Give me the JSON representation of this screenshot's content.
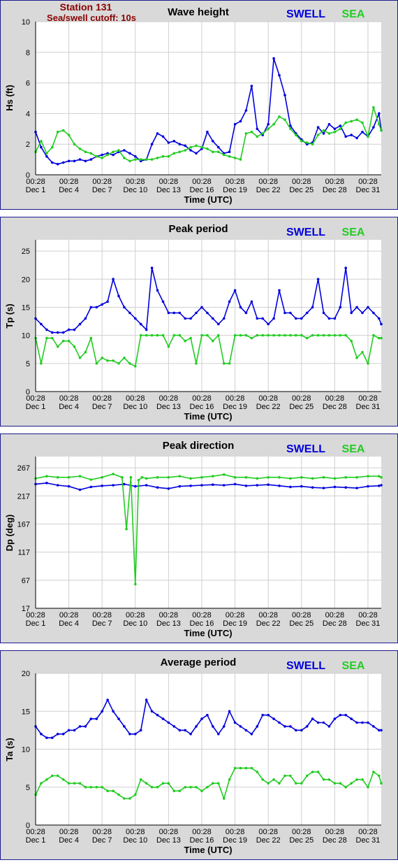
{
  "station": {
    "name": "Station 131",
    "cutoff": "Sea/swell cutoff: 10s"
  },
  "legend": {
    "swell_label": "SWELL",
    "sea_label": "SEA",
    "swell_color": "#0000dd",
    "sea_color": "#22cc22"
  },
  "x_time_labels": [
    "00:28",
    "00:28",
    "00:28",
    "00:28",
    "00:28",
    "00:28",
    "00:28",
    "00:28",
    "00:28",
    "00:28",
    "00:28"
  ],
  "x_date_labels": [
    "Dec 1",
    "Dec 4",
    "Dec 7",
    "Dec 10",
    "Dec 13",
    "Dec 16",
    "Dec 19",
    "Dec 22",
    "Dec 25",
    "Dec 28",
    "Dec 31"
  ],
  "chart_data": [
    {
      "type": "line",
      "title": "Wave height",
      "xlabel": "Time (UTC)",
      "ylabel": "Hs (ft)",
      "ylim": [
        0,
        10
      ],
      "yticks": [
        0,
        2,
        4,
        6,
        8,
        10
      ],
      "xlim": [
        0,
        31.2
      ],
      "grid": true,
      "series": [
        {
          "name": "SWELL",
          "x": [
            0,
            0.5,
            1,
            1.5,
            2,
            2.5,
            3,
            3.5,
            4,
            4.5,
            5,
            5.5,
            6,
            6.5,
            7,
            7.5,
            8,
            8.5,
            9,
            9.5,
            10,
            10.5,
            11,
            11.5,
            12,
            12.5,
            13,
            13.5,
            14,
            14.5,
            15,
            15.5,
            16,
            16.5,
            17,
            17.5,
            18,
            18.5,
            19,
            19.5,
            20,
            20.5,
            21,
            21.5,
            22,
            22.5,
            23,
            23.5,
            24,
            24.5,
            25,
            25.5,
            26,
            26.5,
            27,
            27.5,
            28,
            28.5,
            29,
            29.5,
            30,
            30.5,
            31,
            31.2
          ],
          "y": [
            2.8,
            1.8,
            1.2,
            0.8,
            0.7,
            0.8,
            0.9,
            0.9,
            1.0,
            0.9,
            1.0,
            1.2,
            1.3,
            1.4,
            1.3,
            1.5,
            1.6,
            1.4,
            1.2,
            0.9,
            1.0,
            2.0,
            2.7,
            2.5,
            2.1,
            2.2,
            2.0,
            1.9,
            1.6,
            1.4,
            1.7,
            2.8,
            2.2,
            1.8,
            1.4,
            1.5,
            3.3,
            3.5,
            4.2,
            5.8,
            3.0,
            2.6,
            3.3,
            7.6,
            6.5,
            5.2,
            3.2,
            2.7,
            2.3,
            2.0,
            2.1,
            3.1,
            2.7,
            3.3,
            3.0,
            3.2,
            2.5,
            2.6,
            2.4,
            2.8,
            2.5,
            3.1,
            4.0,
            2.9
          ]
        },
        {
          "name": "SEA",
          "x": [
            0,
            0.5,
            1,
            1.5,
            2,
            2.5,
            3,
            3.5,
            4,
            4.5,
            5,
            5.5,
            6,
            6.5,
            7,
            7.5,
            8,
            8.5,
            9,
            9.5,
            10,
            10.5,
            11,
            11.5,
            12,
            12.5,
            13,
            13.5,
            14,
            14.5,
            15,
            15.5,
            16,
            16.5,
            17,
            17.5,
            18,
            18.5,
            19,
            19.5,
            20,
            20.5,
            21,
            21.5,
            22,
            22.5,
            23,
            23.5,
            24,
            24.5,
            25,
            25.5,
            26,
            26.5,
            27,
            27.5,
            28,
            28.5,
            29,
            29.5,
            30,
            30.5,
            31,
            31.2
          ],
          "y": [
            1.5,
            2.2,
            1.4,
            1.8,
            2.8,
            2.9,
            2.6,
            2.0,
            1.7,
            1.5,
            1.4,
            1.2,
            1.1,
            1.3,
            1.5,
            1.6,
            1.1,
            0.9,
            1.0,
            1.0,
            1.0,
            1.0,
            1.1,
            1.2,
            1.2,
            1.4,
            1.5,
            1.6,
            1.8,
            1.9,
            1.8,
            1.7,
            1.5,
            1.5,
            1.3,
            1.2,
            1.1,
            1.0,
            2.7,
            2.8,
            2.5,
            2.7,
            3.0,
            3.3,
            3.8,
            3.6,
            3.0,
            2.6,
            2.2,
            2.1,
            2.0,
            2.6,
            2.9,
            2.7,
            2.8,
            3.0,
            3.4,
            3.5,
            3.6,
            3.4,
            2.5,
            4.4,
            3.3,
            2.9
          ]
        }
      ]
    },
    {
      "type": "line",
      "title": "Peak period",
      "xlabel": "Time (UTC)",
      "ylabel": "Tp (s)",
      "ylim": [
        0,
        27
      ],
      "yticks": [
        0,
        5,
        10,
        15,
        20,
        25
      ],
      "xlim": [
        0,
        31.2
      ],
      "grid": true,
      "series": [
        {
          "name": "SWELL",
          "x": [
            0,
            0.5,
            1,
            1.5,
            2,
            2.5,
            3,
            3.5,
            4,
            4.5,
            5,
            5.5,
            6,
            6.5,
            7,
            7.5,
            8,
            8.5,
            9,
            9.5,
            10,
            10.5,
            11,
            11.5,
            12,
            12.5,
            13,
            13.5,
            14,
            14.5,
            15,
            15.5,
            16,
            16.5,
            17,
            17.5,
            18,
            18.5,
            19,
            19.5,
            20,
            20.5,
            21,
            21.5,
            22,
            22.5,
            23,
            23.5,
            24,
            24.5,
            25,
            25.5,
            26,
            26.5,
            27,
            27.5,
            28,
            28.5,
            29,
            29.5,
            30,
            30.5,
            31,
            31.2
          ],
          "y": [
            13,
            12,
            11,
            10.5,
            10.5,
            10.5,
            11,
            11,
            12,
            13,
            15,
            15,
            15.5,
            16,
            20,
            17,
            15,
            14,
            13,
            12,
            11,
            22,
            18,
            16,
            14,
            14,
            14,
            13,
            13,
            14,
            15,
            14,
            13,
            12,
            13,
            16,
            18,
            15,
            14,
            16,
            13,
            13,
            12,
            13,
            18,
            14,
            14,
            13,
            13,
            14,
            15,
            20,
            14,
            13,
            13,
            15,
            22,
            14,
            15,
            14,
            15,
            14,
            13,
            12
          ]
        },
        {
          "name": "SEA",
          "x": [
            0,
            0.5,
            1,
            1.5,
            2,
            2.5,
            3,
            3.5,
            4,
            4.5,
            5,
            5.5,
            6,
            6.5,
            7,
            7.5,
            8,
            8.5,
            9,
            9.5,
            10,
            10.5,
            11,
            11.5,
            12,
            12.5,
            13,
            13.5,
            14,
            14.5,
            15,
            15.5,
            16,
            16.5,
            17,
            17.5,
            18,
            18.5,
            19,
            19.5,
            20,
            20.5,
            21,
            21.5,
            22,
            22.5,
            23,
            23.5,
            24,
            24.5,
            25,
            25.5,
            26,
            26.5,
            27,
            27.5,
            28,
            28.5,
            29,
            29.5,
            30,
            30.5,
            31,
            31.2
          ],
          "y": [
            9.5,
            5,
            9.5,
            9.5,
            8,
            9,
            9,
            8,
            6,
            7,
            9.5,
            5,
            6,
            5.5,
            5.5,
            5,
            6,
            5,
            4.5,
            10,
            10,
            10,
            10,
            10,
            8,
            10,
            10,
            9,
            9.5,
            5,
            10,
            10,
            9,
            10,
            5,
            5,
            10,
            10,
            10,
            9.5,
            10,
            10,
            10,
            10,
            10,
            10,
            10,
            10,
            10,
            9.5,
            10,
            10,
            10,
            10,
            10,
            10,
            10,
            9,
            6,
            7,
            5,
            10,
            9.5,
            9.5
          ]
        }
      ]
    },
    {
      "type": "line",
      "title": "Peak direction",
      "xlabel": "Time (UTC)",
      "ylabel": "Dp (deg)",
      "ylim": [
        17,
        287
      ],
      "yticks": [
        17,
        67,
        117,
        167,
        217,
        267
      ],
      "xlim": [
        0,
        31.2
      ],
      "grid": true,
      "series": [
        {
          "name": "SWELL",
          "x": [
            0,
            1,
            2,
            3,
            4,
            5,
            6,
            7,
            8,
            9,
            10,
            11,
            12,
            13,
            14,
            15,
            16,
            17,
            18,
            19,
            20,
            21,
            22,
            23,
            24,
            25,
            26,
            27,
            28,
            29,
            30,
            31,
            31.2
          ],
          "y": [
            238,
            240,
            236,
            234,
            228,
            233,
            235,
            236,
            238,
            234,
            236,
            232,
            230,
            234,
            235,
            236,
            237,
            236,
            238,
            235,
            236,
            237,
            235,
            233,
            234,
            232,
            231,
            233,
            232,
            231,
            234,
            235,
            236
          ]
        },
        {
          "name": "SEA",
          "x": [
            0,
            1,
            2,
            3,
            4,
            5,
            6,
            7,
            7.8,
            8.2,
            8.6,
            9,
            9.3,
            9.6,
            10,
            11,
            12,
            13,
            14,
            15,
            16,
            17,
            18,
            19,
            20,
            21,
            22,
            23,
            24,
            25,
            26,
            27,
            28,
            29,
            30,
            31,
            31.2
          ],
          "y": [
            248,
            252,
            250,
            250,
            252,
            246,
            250,
            256,
            250,
            158,
            250,
            60,
            245,
            250,
            248,
            250,
            250,
            252,
            248,
            250,
            252,
            255,
            250,
            250,
            248,
            250,
            250,
            248,
            250,
            248,
            250,
            248,
            250,
            250,
            252,
            252,
            250
          ]
        }
      ]
    },
    {
      "type": "line",
      "title": "Average period",
      "xlabel": "Time (UTC)",
      "ylabel": "Ta (s)",
      "ylim": [
        0,
        20
      ],
      "yticks": [
        0,
        5,
        10,
        15,
        20
      ],
      "xlim": [
        0,
        31.2
      ],
      "grid": true,
      "series": [
        {
          "name": "SWELL",
          "x": [
            0,
            0.5,
            1,
            1.5,
            2,
            2.5,
            3,
            3.5,
            4,
            4.5,
            5,
            5.5,
            6,
            6.5,
            7,
            7.5,
            8,
            8.5,
            9,
            9.5,
            10,
            10.5,
            11,
            11.5,
            12,
            12.5,
            13,
            13.5,
            14,
            14.5,
            15,
            15.5,
            16,
            16.5,
            17,
            17.5,
            18,
            18.5,
            19,
            19.5,
            20,
            20.5,
            21,
            21.5,
            22,
            22.5,
            23,
            23.5,
            24,
            24.5,
            25,
            25.5,
            26,
            26.5,
            27,
            27.5,
            28,
            28.5,
            29,
            29.5,
            30,
            30.5,
            31,
            31.2
          ],
          "y": [
            13,
            12,
            11.5,
            11.5,
            12,
            12,
            12.5,
            12.5,
            13,
            13,
            14,
            14,
            15,
            16.5,
            15,
            14,
            13,
            12,
            12,
            12.5,
            16.5,
            15,
            14.5,
            14,
            13.5,
            13,
            12.5,
            12.5,
            12,
            13,
            14,
            14.5,
            13,
            12,
            13,
            15,
            13.5,
            13,
            12.5,
            12,
            13,
            14.5,
            14.5,
            14,
            13.5,
            13,
            13,
            12.5,
            12.5,
            13,
            14,
            13.5,
            13.5,
            13,
            14,
            14.5,
            14.5,
            14,
            13.5,
            13.5,
            13.5,
            13,
            12.5,
            12.5
          ]
        },
        {
          "name": "SEA",
          "x": [
            0,
            0.5,
            1,
            1.5,
            2,
            2.5,
            3,
            3.5,
            4,
            4.5,
            5,
            5.5,
            6,
            6.5,
            7,
            7.5,
            8,
            8.5,
            9,
            9.5,
            10,
            10.5,
            11,
            11.5,
            12,
            12.5,
            13,
            13.5,
            14,
            14.5,
            15,
            15.5,
            16,
            16.5,
            17,
            17.5,
            18,
            18.5,
            19,
            19.5,
            20,
            20.5,
            21,
            21.5,
            22,
            22.5,
            23,
            23.5,
            24,
            24.5,
            25,
            25.5,
            26,
            26.5,
            27,
            27.5,
            28,
            28.5,
            29,
            29.5,
            30,
            30.5,
            31,
            31.2
          ],
          "y": [
            4,
            5.5,
            6,
            6.5,
            6.5,
            6,
            5.5,
            5.5,
            5.5,
            5,
            5,
            5,
            5,
            4.5,
            4.5,
            4,
            3.5,
            3.5,
            4,
            6,
            5.5,
            5,
            5,
            5.5,
            5.5,
            4.5,
            4.5,
            5,
            5,
            5,
            4.5,
            5,
            5.5,
            5.5,
            3.5,
            6,
            7.5,
            7.5,
            7.5,
            7.5,
            7,
            6,
            5.5,
            6,
            5.5,
            6.5,
            6.5,
            5.5,
            5.5,
            6.5,
            7,
            7,
            6,
            6,
            5.5,
            5.5,
            5,
            5.5,
            6,
            6,
            5,
            7,
            6.5,
            5.5
          ]
        }
      ]
    }
  ]
}
